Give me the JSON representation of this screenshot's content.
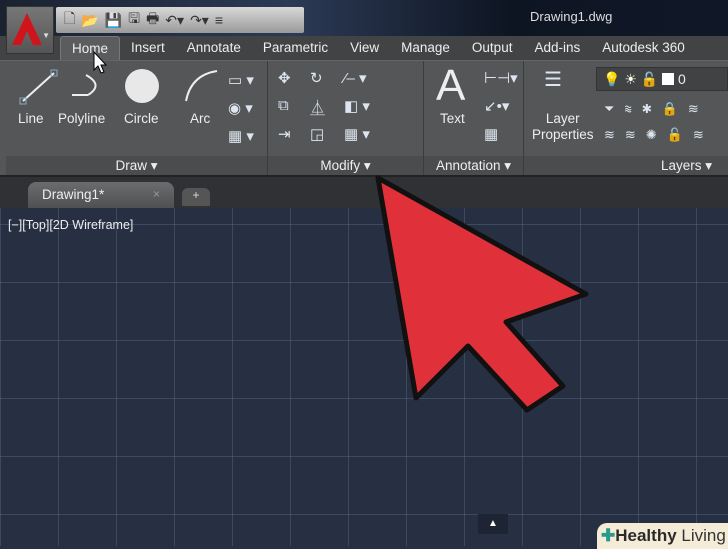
{
  "window": {
    "title": "Drawing1.dwg"
  },
  "ribbon_tabs": [
    "Home",
    "Insert",
    "Annotate",
    "Parametric",
    "View",
    "Manage",
    "Output",
    "Add-ins",
    "Autodesk 360"
  ],
  "draw": {
    "title": "Draw",
    "tools": [
      "Line",
      "Polyline",
      "Circle",
      "Arc"
    ]
  },
  "modify": {
    "title": "Modify"
  },
  "annotation": {
    "title": "Annotation",
    "text": "Text",
    "big_glyph": "A"
  },
  "layers": {
    "title": "Layers",
    "props_line1": "Layer",
    "props_line2": "Properties",
    "current_layer": "0"
  },
  "doc_tab": {
    "label": "Drawing1*",
    "close": "×",
    "new": "+"
  },
  "viewport": {
    "label": "[−][Top][2D Wireframe]"
  },
  "watermark": {
    "brand_bold": "Healthy",
    "brand": "Living"
  },
  "colors": {
    "arrow": "#e0303a",
    "canvas": "#263042",
    "ribbon": "#545658"
  }
}
